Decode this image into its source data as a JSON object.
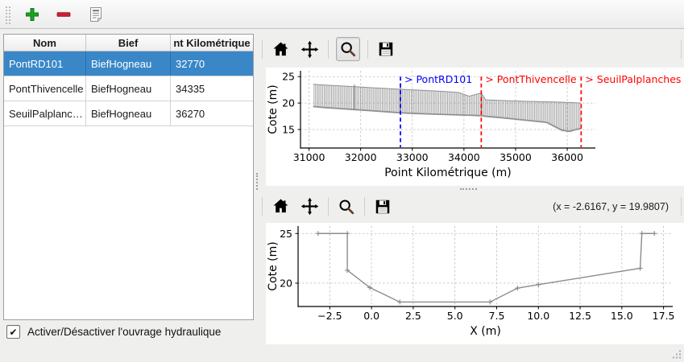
{
  "main_toolbar": {
    "buttons": [
      {
        "name": "add-button",
        "icon": "plus-icon",
        "color": "#1ba322",
        "edge": "#0e7a17"
      },
      {
        "name": "remove-button",
        "icon": "minus-icon",
        "color": "#ce1d2c",
        "edge": "#8e1520"
      },
      {
        "name": "edit-button",
        "icon": "document-icon"
      }
    ]
  },
  "table": {
    "columns": [
      "Nom",
      "Bief",
      "nt Kilométrique"
    ],
    "rows": [
      {
        "nom": "PontRD101",
        "bief": "BiefHogneau",
        "pk": "32770",
        "selected": true
      },
      {
        "nom": "PontThivencelle",
        "bief": "BiefHogneau",
        "pk": "34335",
        "selected": false
      },
      {
        "nom": "SeuilPalplanc…",
        "bief": "BiefHogneau",
        "pk": "36270",
        "selected": false
      }
    ],
    "selection_color": "#3a87c8"
  },
  "checkbox": {
    "checked": true,
    "glyph": "✔",
    "label": "Activer/Désactiver l'ouvrage hydraulique"
  },
  "plot_toolbars": {
    "icons": [
      "home-icon",
      "pan-icon",
      "zoom-icon",
      "save-icon"
    ],
    "top_zoom_pressed": true,
    "coords_readout": "(x = -2.6167,  y = 19.9807)"
  },
  "chart_data": [
    {
      "type": "area",
      "name": "profil-en-long",
      "xlabel": "Point Kilométrique (m)",
      "ylabel": "Cote (m)",
      "xlim": [
        30835,
        36545
      ],
      "ylim": [
        11.5,
        26.1
      ],
      "xticks": [
        31000,
        32000,
        33000,
        34000,
        35000,
        36000
      ],
      "yticks": [
        15,
        20,
        25
      ],
      "grid": true,
      "band_color": "#909090",
      "series": [
        {
          "name": "fond",
          "x": [
            31080,
            31300,
            31600,
            31900,
            32200,
            32500,
            32770,
            33000,
            33300,
            33600,
            33900,
            34100,
            34250,
            34335,
            34420,
            34700,
            35000,
            35300,
            35600,
            35750,
            35900,
            36050,
            36150,
            36270
          ],
          "y": [
            19.35,
            19.15,
            18.95,
            18.75,
            18.55,
            18.35,
            18.15,
            18.05,
            17.95,
            17.85,
            17.75,
            17.7,
            17.65,
            17.6,
            17.5,
            17.25,
            16.95,
            16.65,
            16.35,
            15.6,
            14.85,
            14.65,
            14.95,
            15.2
          ]
        },
        {
          "name": "berge",
          "x": [
            31080,
            31300,
            31600,
            31900,
            32200,
            32500,
            32770,
            33000,
            33300,
            33600,
            33900,
            34100,
            34250,
            34335,
            34420,
            34700,
            35000,
            35300,
            35600,
            35750,
            35900,
            36050,
            36150,
            36270
          ],
          "y": [
            23.55,
            23.4,
            23.25,
            23.1,
            22.9,
            22.75,
            22.6,
            22.5,
            22.35,
            22.2,
            22.0,
            21.3,
            21.7,
            21.85,
            20.6,
            20.5,
            20.4,
            20.3,
            20.25,
            20.2,
            20.15,
            20.1,
            20.05,
            20.0
          ]
        }
      ],
      "spikes": [
        {
          "x": 31880,
          "y0": 18.76,
          "y1": 23.45
        },
        {
          "x": 32770,
          "y0": 18.15,
          "y1": 23.8
        },
        {
          "x": 34335,
          "y0": 17.6,
          "y1": 21.9
        }
      ],
      "annotations": [
        {
          "label": "> PontRD101",
          "x": 32770,
          "color": "#0000ff"
        },
        {
          "label": "> PontThivencelle",
          "x": 34335,
          "color": "#ff0000"
        },
        {
          "label": "> SeuilPalplanches",
          "x": 36270,
          "color": "#ff0000"
        }
      ]
    },
    {
      "type": "line",
      "name": "section-en-travers",
      "xlabel": "X (m)",
      "ylabel": "Cote (m)",
      "xlim": [
        -4.4,
        18.05
      ],
      "ylim": [
        17.65,
        25.75
      ],
      "xticks": [
        -2.5,
        0,
        2.5,
        5,
        7.5,
        10,
        12.5,
        15,
        17.5
      ],
      "yticks": [
        20,
        25
      ],
      "xtick_decimals": 1,
      "grid": true,
      "line_color": "#8c8c8c",
      "series": [
        {
          "name": "section",
          "marker": "+",
          "x": [
            -3.2,
            -1.45,
            -1.45,
            -0.1,
            1.7,
            7.1,
            8.75,
            10.0,
            16.1,
            16.2,
            16.95
          ],
          "y": [
            25,
            25,
            21.3,
            19.55,
            18.1,
            18.1,
            19.5,
            19.85,
            21.5,
            25,
            25
          ]
        }
      ]
    }
  ]
}
